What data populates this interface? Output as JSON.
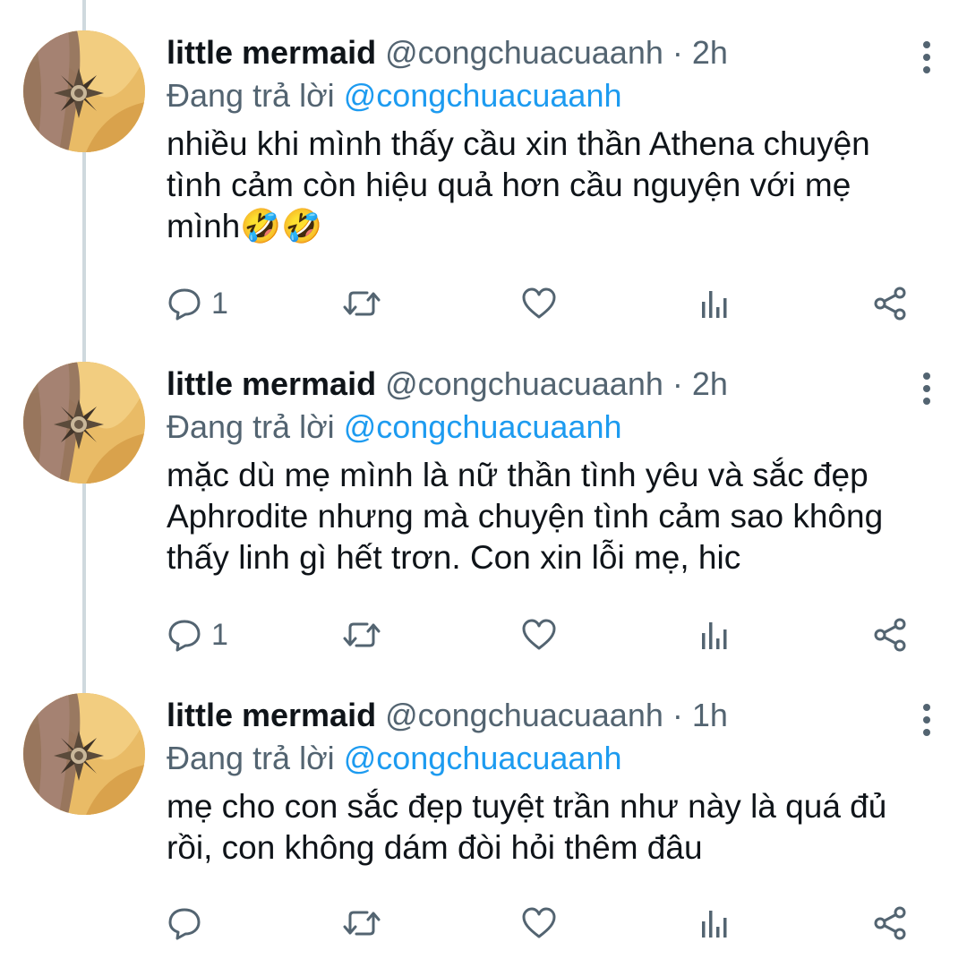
{
  "colors": {
    "accent": "#1d9bf0",
    "text": "#0f1419",
    "muted": "#536471",
    "thread_line": "#cfd9de"
  },
  "icons": {
    "more": "more-vertical-icon",
    "reply": "reply-bubble-icon",
    "retweet": "retweet-icon",
    "like": "heart-icon",
    "analytics": "analytics-bars-icon",
    "share": "share-icon"
  },
  "tweets": [
    {
      "name": "little mermaid",
      "handle": "@congchuacuaanh",
      "separator": "·",
      "time": "2h",
      "reply_prefix": "Đang trả lời",
      "reply_to": "@congchuacuaanh",
      "text": "nhiều khi mình thấy cầu xin thần Athena chuyện tình cảm còn hiệu quả hơn cầu nguyện với mẹ mình🤣🤣",
      "reply_count": "1"
    },
    {
      "name": "little mermaid",
      "handle": "@congchuacuaanh",
      "separator": "·",
      "time": "2h",
      "reply_prefix": "Đang trả lời",
      "reply_to": "@congchuacuaanh",
      "text": "mặc dù mẹ mình là nữ thần tình yêu và sắc đẹp Aphrodite nhưng mà chuyện tình cảm sao không thấy linh gì hết trơn. Con xin lỗi mẹ, hic",
      "reply_count": "1"
    },
    {
      "name": "little mermaid",
      "handle": "@congchuacuaanh",
      "separator": "·",
      "time": "1h",
      "reply_prefix": "Đang trả lời",
      "reply_to": "@congchuacuaanh",
      "text": "mẹ cho con sắc đẹp tuyệt trần như này là quá đủ rồi, con không dám đòi hỏi thêm đâu",
      "reply_count": ""
    }
  ]
}
